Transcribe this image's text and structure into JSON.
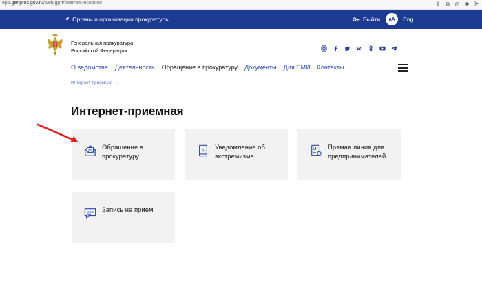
{
  "browser": {
    "url_prefix": "epp.",
    "url_host": "genproc.gov.ru",
    "url_path": "/web/gprf/internet-reception"
  },
  "topbar": {
    "orgs_link": "Органы и организации прокуратуры",
    "logout": "Выйти",
    "font_size_toggle": "аА",
    "lang": "Eng"
  },
  "brand": {
    "line1": "Генеральная прокуратура",
    "line2": "Российской Федерации"
  },
  "social_icons": [
    "instagram-icon",
    "facebook-icon",
    "twitter-icon",
    "vk-icon",
    "odnoklassniki-icon",
    "youtube-icon",
    "telegram-icon"
  ],
  "nav": {
    "items": [
      {
        "label": "О ведомстве",
        "active": false
      },
      {
        "label": "Деятельность",
        "active": false
      },
      {
        "label": "Обращение в прокуратуру",
        "active": true
      },
      {
        "label": "Документы",
        "active": false
      },
      {
        "label": "Для СМИ",
        "active": false
      },
      {
        "label": "Контакты",
        "active": false
      }
    ]
  },
  "breadcrumb": {
    "current": "Интернет-приемная"
  },
  "page": {
    "title": "Интернет-приемная"
  },
  "cards": [
    {
      "label": "Обращение в прокуратуру",
      "icon": "envelope-icon"
    },
    {
      "label": "Уведомление об экстремизме",
      "icon": "book-icon"
    },
    {
      "label": "Прямая линия для предпринимателей",
      "icon": "document-icon"
    },
    {
      "label": "Запись на прием",
      "icon": "chat-icon"
    }
  ],
  "colors": {
    "topbar": "#1d3a92",
    "link": "#2c4ab5",
    "card_bg": "#f2f2f2",
    "icon": "#2c4ab5",
    "annotation_arrow": "#e02020"
  }
}
